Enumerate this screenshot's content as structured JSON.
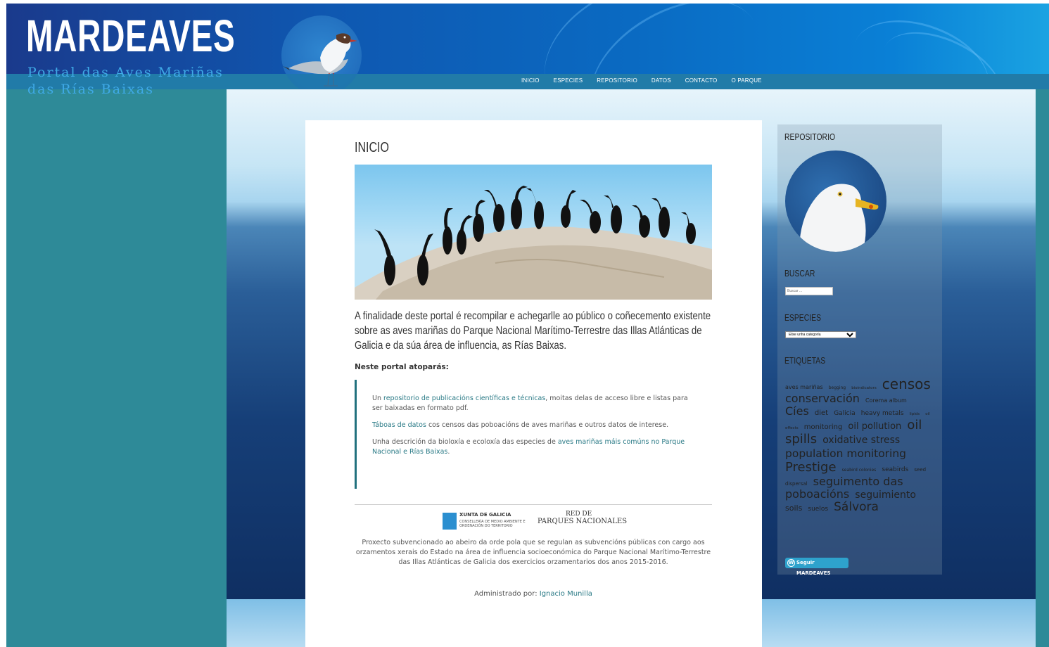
{
  "header": {
    "site_title": "MARDEAVES",
    "tagline": "Portal das Aves Mariñas das Rías Baixas"
  },
  "nav": {
    "items": [
      "INICIO",
      "ESPECIES",
      "REPOSITORIO",
      "DATOS",
      "CONTACTO",
      "O PARQUE"
    ]
  },
  "main": {
    "page_title": "INICIO",
    "intro": "A finalidade deste portal é recompilar e achegarlle ao público o coñecemento existente sobre as aves mariñas do Parque Nacional Marítimo-Terrestre das Illas Atlánticas de Galicia e da súa área de influencia, as Rías Baixas.",
    "find_heading": "Neste portal atoparás:",
    "items": [
      {
        "pre": "Un ",
        "link": "repositorio de publicacións científicas e técnicas",
        "post": ", moitas delas de acceso libre e listas para ser baixadas en formato pdf."
      },
      {
        "pre": "",
        "link": "Táboas de datos",
        "post": " cos censos das poboacións de aves mariñas e outros datos de interese."
      },
      {
        "pre": "Unha descrición da bioloxía e ecoloxía das especies de ",
        "link": "aves mariñas máis comúns no Parque Nacional e Rías Baixas",
        "post": "."
      }
    ],
    "xunta": "XUNTA DE GALICIA",
    "xunta_sub": "CONSELLERÍA DE MEDIO AMBIENTE E ORDENACIÓN DO TERRITORIO",
    "rpn_top": "RED DE",
    "rpn_main": "PARQUES NACIONALES",
    "funding": "Proxecto subvencionado ao abeiro da orde pola que se regulan as subvencións públicas con cargo aos orzamentos xerais do Estado na área de influencia socioeconómica do Parque Nacional Marítimo-Terrestre das Illas Atlánticas de Galicia dos exercicios orzamentarios dos anos 2015-2016.",
    "admin_label": "Administrado por:",
    "admin_name": "Ignacio Munilla"
  },
  "sidebar": {
    "repositorio_title": "REPOSITORIO",
    "buscar_title": "BUSCAR",
    "search_placeholder": "Buscar ...",
    "especies_title": "ESPECIES",
    "select_option": "Elixe unha categoría",
    "etiquetas_title": "ETIQUETAS",
    "tags": [
      {
        "text": "aves mariñas",
        "size": 8
      },
      {
        "text": "begging",
        "size": 6
      },
      {
        "text": "bioindicators",
        "size": 5.5
      },
      {
        "text": "censos",
        "size": 20
      },
      {
        "text": "conservación",
        "size": 16
      },
      {
        "text": "Corema album",
        "size": 8
      },
      {
        "text": "Cíes",
        "size": 16
      },
      {
        "text": "diet",
        "size": 10
      },
      {
        "text": "Galicia",
        "size": 9
      },
      {
        "text": "heavy metals",
        "size": 9
      },
      {
        "text": "lipids",
        "size": 5.5
      },
      {
        "text": "oil effects",
        "size": 5.5
      },
      {
        "text": "monitoring",
        "size": 10
      },
      {
        "text": "oil pollution",
        "size": 13
      },
      {
        "text": "oil spills",
        "size": 18
      },
      {
        "text": "oxidative stress",
        "size": 14
      },
      {
        "text": "population monitoring",
        "size": 15.5
      },
      {
        "text": "Prestige",
        "size": 18
      },
      {
        "text": "seabird colonies",
        "size": 6
      },
      {
        "text": "seabirds",
        "size": 9
      },
      {
        "text": "seed dispersal",
        "size": 7
      },
      {
        "text": "seguimento das poboacións",
        "size": 16
      },
      {
        "text": "seguimiento",
        "size": 14
      },
      {
        "text": "soils",
        "size": 11
      },
      {
        "text": "suelos",
        "size": 9
      },
      {
        "text": "Sálvora",
        "size": 17
      }
    ],
    "follow_label": "Seguir MARDEAVES"
  }
}
